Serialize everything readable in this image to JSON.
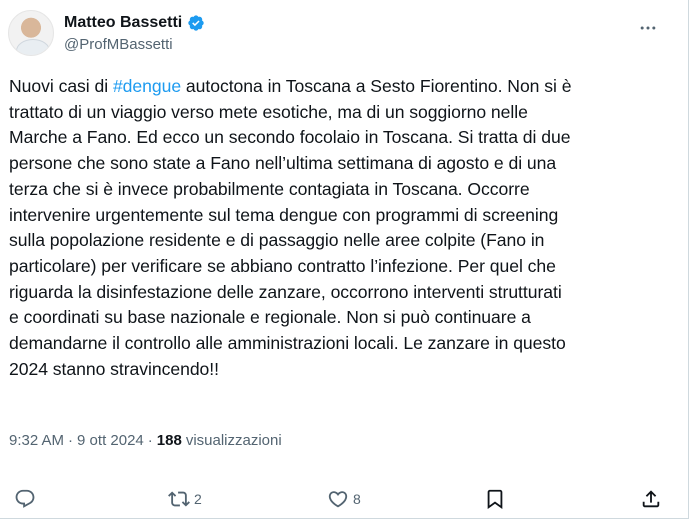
{
  "author": {
    "display_name": "Matteo Bassetti",
    "handle": "@ProfMBassetti",
    "verified": true
  },
  "tweet": {
    "lines": [
      {
        "before": "Nuovi casi di ",
        "hashtag": "#dengue",
        "after": " autoctona in Toscana a Sesto Fiorentino. Non si è"
      },
      {
        "text": "trattato di un viaggio verso mete esotiche, ma di un soggiorno nelle"
      },
      {
        "text": "Marche a Fano. Ed ecco un secondo focolaio in Toscana. Si tratta di due"
      },
      {
        "text": "persone che sono state a Fano nell’ultima settimana di agosto e di una"
      },
      {
        "text": "terza che si è invece probabilmente contagiata in Toscana. Occorre"
      },
      {
        "text": "intervenire urgentemente sul tema dengue con programmi  di screening"
      },
      {
        "text": "sulla popolazione residente e di passaggio nelle aree colpite (Fano in"
      },
      {
        "text": "particolare) per verificare se abbiano contratto l’infezione. Per quel che"
      },
      {
        "text": "riguarda la disinfestazione delle zanzare, occorrono interventi strutturati"
      },
      {
        "text": "e coordinati su base nazionale e regionale. Non si può continuare a"
      },
      {
        "text": "demandarne il controllo alle amministrazioni locali. Le zanzare in questo"
      },
      {
        "text": "2024 stanno stravincendo!!"
      }
    ]
  },
  "meta": {
    "time": "9:32 AM",
    "separator": "·",
    "date": "9 ott 2024",
    "views_count": "188",
    "views_label": "visualizzazioni"
  },
  "actions": {
    "reply": {
      "icon": "reply-icon",
      "count": ""
    },
    "retweet": {
      "icon": "retweet-icon",
      "count": "2"
    },
    "like": {
      "icon": "like-icon",
      "count": "8"
    },
    "bookmark": {
      "icon": "bookmark-icon",
      "count": ""
    },
    "share": {
      "icon": "share-icon",
      "count": ""
    }
  },
  "colors": {
    "accent": "#1d9bf0",
    "text": "#0f1419",
    "secondary": "#536471"
  }
}
